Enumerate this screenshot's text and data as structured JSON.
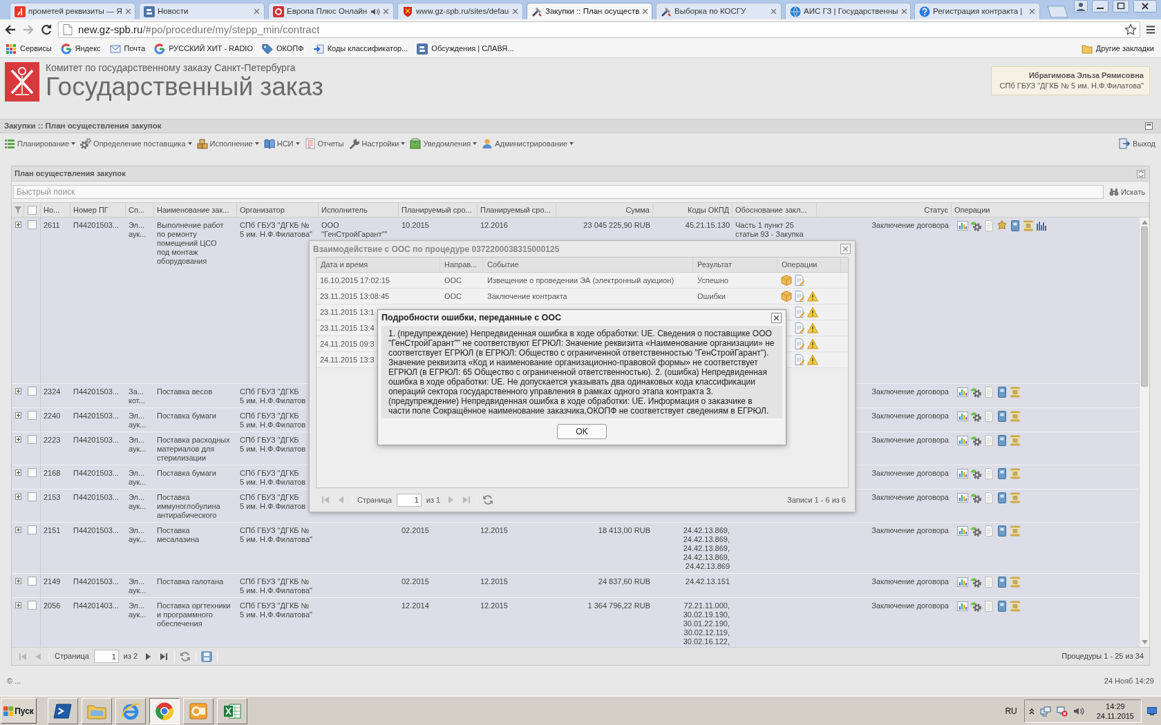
{
  "browser": {
    "tabs": [
      {
        "title": "прометей реквизиты — Я",
        "selected": false,
        "audio": false
      },
      {
        "title": "Новости",
        "selected": false,
        "audio": false
      },
      {
        "title": "Европа Плюс Онлайн",
        "selected": false,
        "audio": true
      },
      {
        "title": "www.gz-spb.ru/sites/defau",
        "selected": false,
        "audio": false
      },
      {
        "title": "Закупки :: План осуществ",
        "selected": true,
        "audio": false
      },
      {
        "title": "Выборка по КОСГУ",
        "selected": false,
        "audio": false
      },
      {
        "title": "АИС ГЗ | Государственны",
        "selected": false,
        "audio": false
      },
      {
        "title": "Регистрация контракта |",
        "selected": false,
        "audio": false
      }
    ],
    "address": {
      "host": "new.gz-spb.ru",
      "path": "/#po/procedure/my/stepp_min/contract"
    },
    "bookmarks": [
      "Сервисы",
      "Яндекс",
      "Почта",
      "РУССКИЙ ХИТ - RADIO",
      "ОКОПФ",
      "Коды классификатор...",
      "Обсуждения | СЛАВЯ..."
    ],
    "other_bookmarks": "Другие закладки"
  },
  "header": {
    "organization": "Комитет по государственному заказу Санкт-Петербурга",
    "title": "Государственный заказ",
    "user_name": "Ибрагимова Эльза Рямисовна",
    "user_org": "СПб ГБУЗ \"ДГКБ № 5 им. Н.Ф.Филатова\""
  },
  "page_title": "Закупки :: План осуществления закупок",
  "menu": [
    {
      "label": "Планирование",
      "dropdown": true
    },
    {
      "label": "Определение поставщика",
      "dropdown": true
    },
    {
      "label": "Исполнение",
      "dropdown": true
    },
    {
      "label": "НСИ",
      "dropdown": true
    },
    {
      "label": "Отчеты",
      "dropdown": false
    },
    {
      "label": "Настройки",
      "dropdown": true
    },
    {
      "label": "Уведомления",
      "dropdown": true
    },
    {
      "label": "Администрирование",
      "dropdown": true
    }
  ],
  "logout": "Выход",
  "panel": {
    "title": "План осуществления закупок",
    "search": {
      "placeholder": "Быстрый поиск",
      "button": "Искать"
    },
    "table": {
      "select_all": {
        "checked": false
      },
      "columns": [
        "Но...",
        "Номер ПГ",
        "Сп...",
        "Наименование зак...",
        "Организатор",
        "Исполнитель",
        "Планируемый сро...",
        "Планируемый сро...",
        "Сумма",
        "Коды ОКПД",
        "Обоснование закл...",
        "Статус",
        "Операции"
      ],
      "rows": [
        {
          "kind": "extended",
          "expanded": false,
          "checked": false,
          "number": "2611",
          "plan_number": "П44201503...",
          "column_3": "Эл...\nаук...",
          "name": "Выполнение работ\nпо ремонту\nпомещений ЦСО\nпод монтаж\nоборудования",
          "organizer": "СПб ГБУЗ \"ДГКБ №\n5 им. Н.Ф.Филатова\"",
          "executor": "ООО\n\"ГенСтройГарант\"\"",
          "planned_1": "10.2015",
          "planned_2": "12.2016",
          "amount": "23 045 225,90 RUB",
          "okpd": "45.21.15.130",
          "basis": "Часть 1 пункт 25\nстатьи 93 - Закупка",
          "status": "Заключение договора"
        },
        {
          "kind": "standard",
          "expanded": false,
          "checked": false,
          "number": "2324",
          "plan_number": "П44201503...",
          "column_3": "За...\nкот...",
          "name": "Поставка весов",
          "organizer": "СПб ГБУЗ \"ДГКБ\n5 им. Н.Ф.Филатов",
          "status": "Заключение договора"
        },
        {
          "kind": "standard",
          "expanded": false,
          "checked": false,
          "number": "2240",
          "plan_number": "П44201503...",
          "column_3": "Эл...\nаук...",
          "name": "Поставка бумаги",
          "organizer": "СПб ГБУЗ \"ДГКБ\n5 им. Н.Ф.Филатов",
          "status": "Заключение договора"
        },
        {
          "kind": "standard",
          "expanded": false,
          "checked": false,
          "number": "2223",
          "plan_number": "П44201503...",
          "column_3": "Эл...\nаук...",
          "name": "Поставка расходных\nматериалов для\nстерилизации",
          "organizer": "СПб ГБУЗ \"ДГКБ\n5 им. Н.Ф.Филатов",
          "status": "Заключение договора"
        },
        {
          "kind": "standard",
          "expanded": false,
          "checked": false,
          "number": "2168",
          "plan_number": "П44201503...",
          "column_3": "Эл...\nаук...",
          "name": "Поставка бумаги",
          "organizer": "СПб ГБУЗ \"ДГКБ\n5 им. Н.Ф.Филатов",
          "status": "Заключение договора"
        },
        {
          "kind": "standard",
          "expanded": false,
          "checked": false,
          "number": "2153",
          "plan_number": "П44201503...",
          "column_3": "Эл...\nаук...",
          "name": "Поставка\nиммуноглобулина\nантирабического",
          "organizer": "СПб ГБУЗ \"ДГКБ\n5 им. Н.Ф.Филатов",
          "status": "Заключение договора"
        },
        {
          "kind": "standard",
          "expanded": false,
          "checked": false,
          "number": "2151",
          "plan_number": "П44201503...",
          "column_3": "Эл...\nаук...",
          "name": "Поставка\nмесалазина",
          "organizer": "СПб ГБУЗ \"ДГКБ №\n5 им. Н.Ф.Филатова\"",
          "planned_1": "02.2015",
          "planned_2": "12.2015",
          "amount": "18 413,00 RUB",
          "okpd": "24.42.13.869,\n24.42.13.869,\n24.42.13.869,\n24.42.13.869,\n24.42.13.869",
          "status": "Заключение договора"
        },
        {
          "kind": "standard",
          "expanded": false,
          "checked": false,
          "number": "2149",
          "plan_number": "П44201503...",
          "column_3": "Эл...\nаук...",
          "name": "Поставка галотана",
          "organizer": "СПб ГБУЗ \"ДГКБ №\n5 им. Н.Ф.Филатова\"",
          "planned_1": "02.2015",
          "planned_2": "12.2015",
          "amount": "24 837,60 RUB",
          "okpd": "24.42.13.151",
          "status": "Заключение договора"
        },
        {
          "kind": "standard",
          "expanded": false,
          "checked": false,
          "number": "2056",
          "plan_number": "П44201403...",
          "column_3": "Эл...\nаук...",
          "name": "Поставка оргтехники\nи программного\nобеспечения",
          "organizer": "СПб ГБУЗ \"ДГКБ №\n5 им. Н.Ф.Филатова\"",
          "planned_1": "12.2014",
          "planned_2": "12.2015",
          "amount": "1 364 796,22 RUB",
          "okpd": "72.21.11.000,\n30.02.19.190,\n30.01.22.190,\n30.02.12.119,\n30.02.16.122,",
          "status": "Заключение договора"
        }
      ]
    },
    "pager": {
      "label": "Страница",
      "page": "1",
      "total": "из 2",
      "summary": "Процедуры 1 - 25 из 34"
    }
  },
  "interaction_dialog": {
    "title": "Взаимодействие с ООС по процедуре 0372200038315000125",
    "columns": [
      "Дата и время",
      "Направ...",
      "Событие",
      "Результат",
      "Операции"
    ],
    "rows": [
      {
        "kind": "success",
        "date": "16.10.2015 17:02:15",
        "direction": "ООС",
        "event": "Извещение о проведении ЭА (электронный аукцион)",
        "result": "Успешно"
      },
      {
        "kind": "error",
        "date": "23.11.2015 13:08:45",
        "direction": "ООС",
        "event": "Заключение контракта",
        "result": "Ошибки"
      },
      {
        "kind": "error",
        "date": "23.11.2015 13:1"
      },
      {
        "kind": "error",
        "date": "23.11.2015 13:4"
      },
      {
        "kind": "error",
        "date": "24.11.2015 09:3"
      },
      {
        "kind": "error",
        "date": "24.11.2015 13:3"
      }
    ],
    "pager": {
      "label": "Страница",
      "page": "1",
      "total": "из 1",
      "summary": "Записи 1 - 6 из 6"
    }
  },
  "error_dialog": {
    "title": "Подробности ошибки, переданные с ООС",
    "message": "1. (предупреждение) Непредвиденная ошибка в ходе обработки: UE. Сведения о поставщике ООО \"ГенСтройГарант\"\" не соответствуют ЕГРЮЛ: Значение реквизита «Наименование организации» не соответствует ЕГРЮЛ (в ЕГРЮЛ: Общество с ограниченной ответственностью \"ГенСтройГарант\"). Значение реквизита «Код и наименование организационно-правовой формы» не соответствует ЕГРЮЛ (в ЕГРЮЛ: 65 Общество с ограниченной ответственностью). 2. (ошибка) Непредвиденная ошибка в ходе обработки: UE. Не допускается указывать два одинаковых кода классификации операций сектора государственного управления в рамках одного этапа контракта 3. (предупреждение) Непредвиденная ошибка в ходе обработки: UE. Информация о заказчике в части поле Сокращённое наименование заказчика,ОКОПФ не соответствует сведениям в ЕГРЮЛ.",
    "button": "OK"
  },
  "status_bar": {
    "left": "© ...",
    "right": "24 Нояб 14:29"
  },
  "taskbar": {
    "start": "Пуск",
    "apps": [
      {
        "selected": false
      },
      {
        "selected": false
      },
      {
        "selected": false
      },
      {
        "selected": true
      },
      {
        "selected": false
      },
      {
        "selected": false
      }
    ],
    "language": "RU",
    "time": "14:29",
    "date": "24.11.2015"
  }
}
